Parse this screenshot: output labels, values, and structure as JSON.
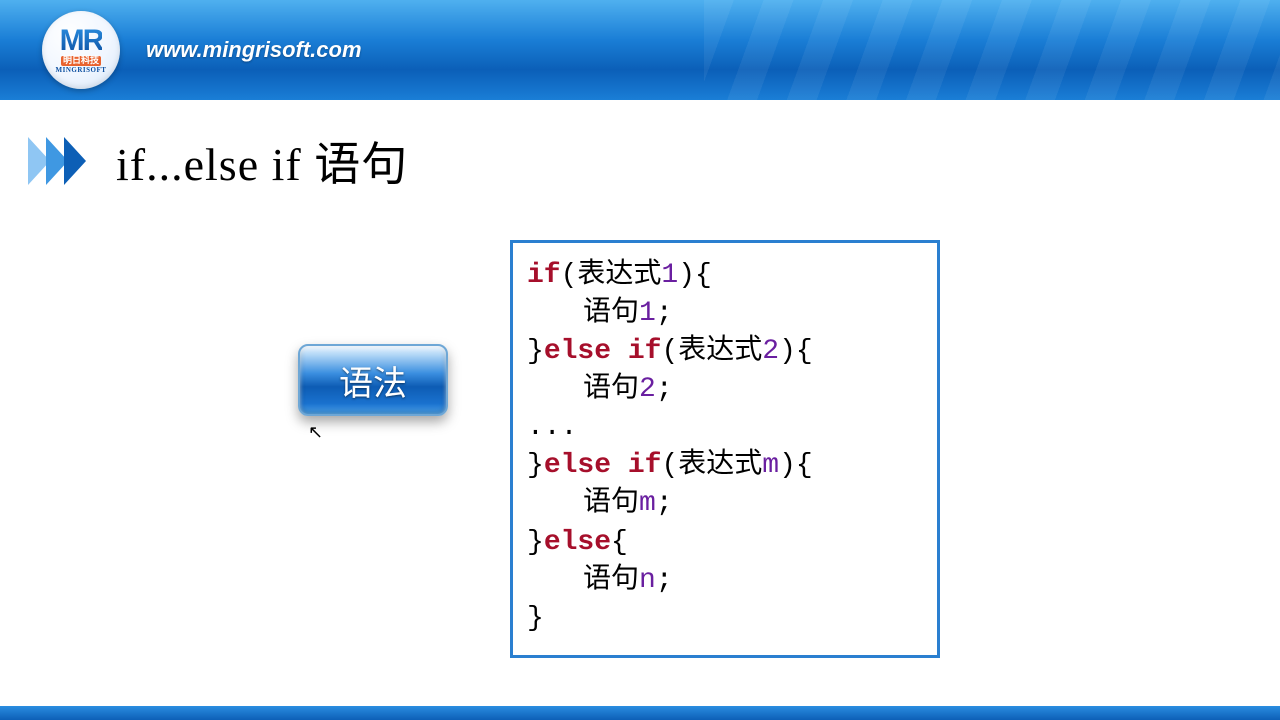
{
  "header": {
    "url": "www.mingrisoft.com",
    "logo_top": "MR",
    "logo_mid": "明日科技",
    "logo_bottom": "MINGRISOFT"
  },
  "title": "if...else if 语句",
  "button_label": "语法",
  "code": {
    "l1": {
      "kw": "if",
      "p1": "(表达式",
      "num": "1",
      "p2": "){"
    },
    "l2": {
      "stmt": "语句",
      "num": "1",
      "semi": ";"
    },
    "l3": {
      "close": "}",
      "kw": "else if",
      "p1": "(表达式",
      "num": "2",
      "p2": "){"
    },
    "l4": {
      "stmt": "语句",
      "num": "2",
      "semi": ";"
    },
    "l5": "...",
    "l6": {
      "close": "}",
      "kw": "else if",
      "p1": "(表达式",
      "num": "m",
      "p2": "){"
    },
    "l7": {
      "stmt": "语句",
      "num": "m",
      "semi": ";"
    },
    "l8": {
      "close": "}",
      "kw": "else",
      "p2": "{"
    },
    "l9": {
      "stmt": "语句",
      "num": "n",
      "semi": ";"
    },
    "l10": "}"
  }
}
